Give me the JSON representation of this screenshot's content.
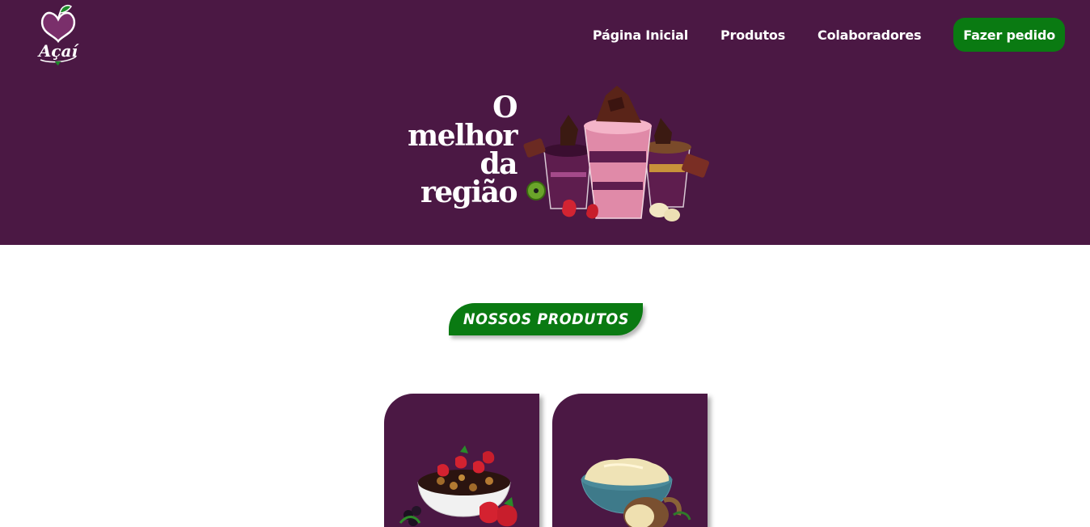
{
  "header": {
    "logo_text": "Açaí",
    "nav": {
      "home": "Página Inicial",
      "products": "Produtos",
      "collaborators": "Colaboradores",
      "cta": "Fazer pedido"
    }
  },
  "hero": {
    "title_lines": [
      "O",
      "melhor",
      "da",
      "região"
    ]
  },
  "products": {
    "section_title": "NOSSOS PRODUTOS",
    "cards": [
      {
        "icon": "acai-bowl-with-strawberries-image"
      },
      {
        "icon": "cupuacu-cream-bowl-image"
      }
    ]
  },
  "colors": {
    "brand_purple": "#4b1844",
    "brand_green": "#0a7a12",
    "background": "#ffffff"
  }
}
